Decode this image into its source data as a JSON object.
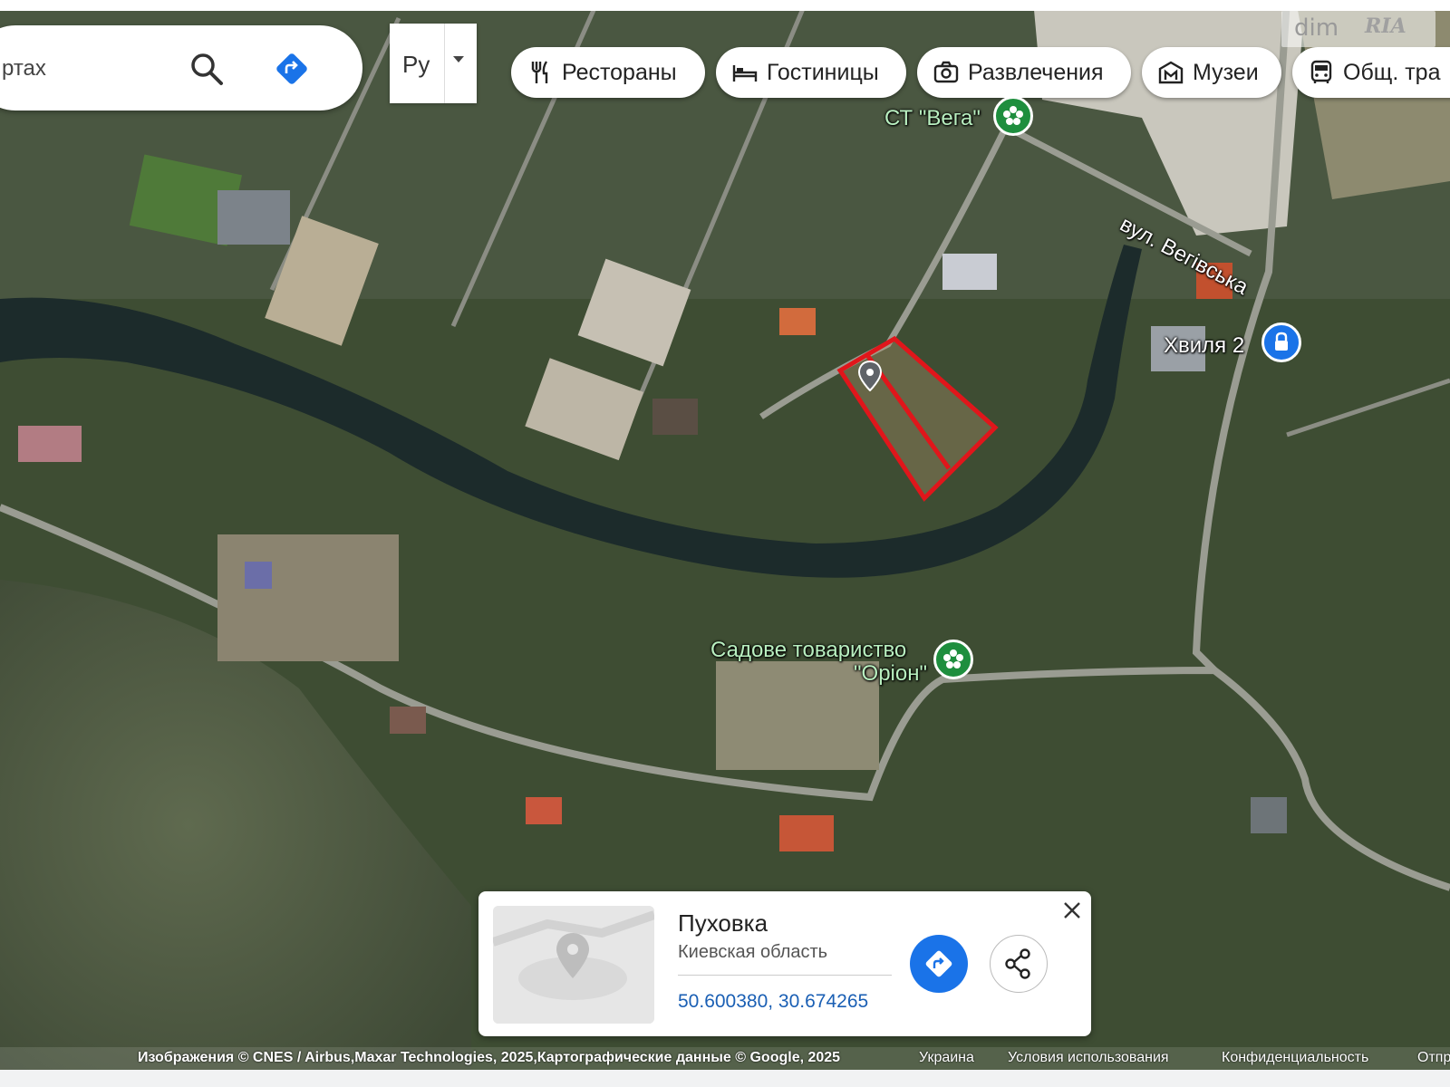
{
  "search": {
    "text": "ртах"
  },
  "language": {
    "value": "Ру"
  },
  "chips": [
    {
      "label": "Рестораны",
      "icon": "fork-knife-icon"
    },
    {
      "label": "Гостиницы",
      "icon": "bed-icon"
    },
    {
      "label": "Развлечения",
      "icon": "camera-icon"
    },
    {
      "label": "Музеи",
      "icon": "museum-icon"
    },
    {
      "label": "Общ. тра",
      "icon": "bus-icon"
    }
  ],
  "watermark": {
    "brand": "dim",
    "mark": "RIA"
  },
  "map_labels": {
    "poi_vega": "СТ \"Вега\"",
    "street": "вул. Вегівська",
    "poi_khvylia": "Хвиля 2",
    "poi_orion_line1": "Садове товариство",
    "poi_orion_line2": "\"Оріон\""
  },
  "place_card": {
    "name": "Пуховка",
    "region": "Киевская область",
    "coordinates": "50.600380, 30.674265"
  },
  "attribution": {
    "imagery": "Изображения © CNES / Airbus,Maxar Technologies, 2025,Картографические данные © Google, 2025",
    "country": "Украина",
    "terms": "Условия использования",
    "privacy": "Конфиденциальность",
    "report": "Отпр"
  },
  "colors": {
    "plot_outline": "#e0161b",
    "directions_blue": "#1a73e8",
    "poi_green": "#1e8e3e",
    "poi_blue": "#1a73e8"
  }
}
